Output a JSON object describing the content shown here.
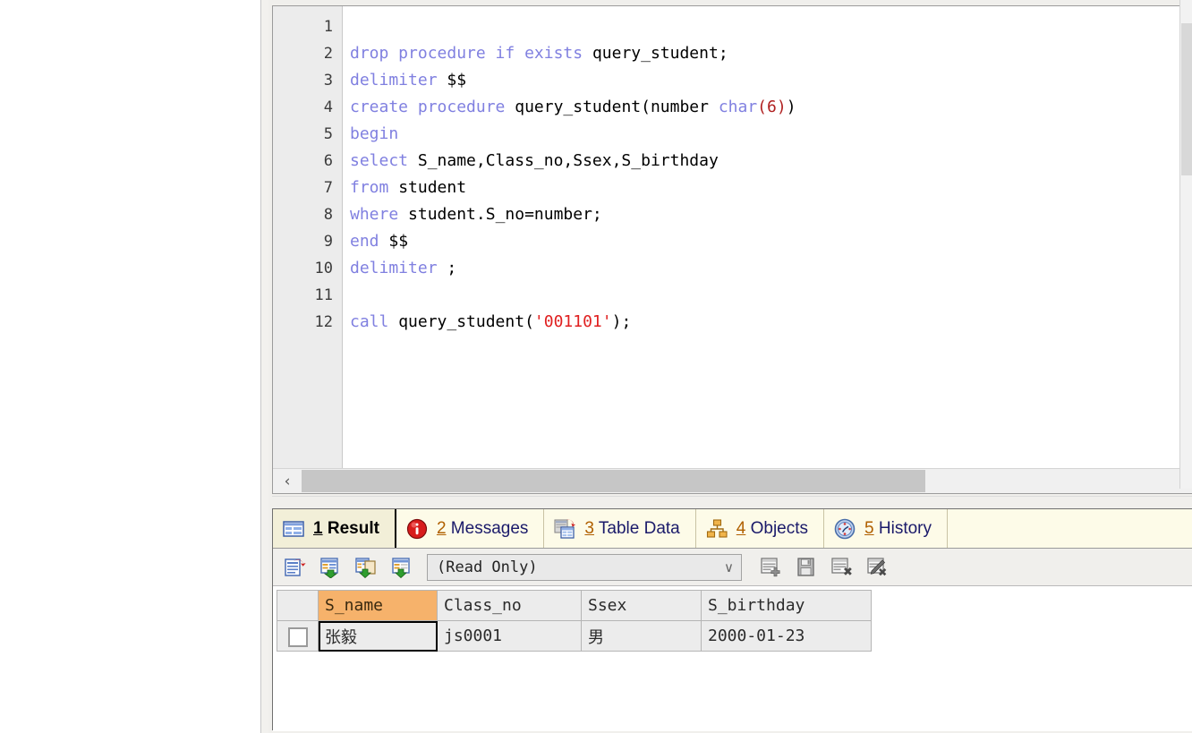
{
  "editor": {
    "line_numbers": [
      "1",
      "2",
      "3",
      "4",
      "5",
      "6",
      "7",
      "8",
      "9",
      "10",
      "11",
      "12"
    ],
    "lines": [
      {
        "n": "1",
        "tokens": [
          {
            "t": "",
            "c": "pln"
          }
        ]
      },
      {
        "n": "2",
        "tokens": [
          {
            "t": "drop procedure if exists ",
            "c": "kw"
          },
          {
            "t": "query_student;",
            "c": "pln"
          }
        ]
      },
      {
        "n": "3",
        "tokens": [
          {
            "t": "delimiter ",
            "c": "kw"
          },
          {
            "t": "$$",
            "c": "pln"
          }
        ]
      },
      {
        "n": "4",
        "tokens": [
          {
            "t": "create procedure ",
            "c": "kw"
          },
          {
            "t": "query_student(number ",
            "c": "pln"
          },
          {
            "t": "char",
            "c": "kw"
          },
          {
            "t": "(6)",
            "c": "num"
          },
          {
            "t": ")",
            "c": "pln"
          }
        ]
      },
      {
        "n": "5",
        "tokens": [
          {
            "t": "begin",
            "c": "kw"
          }
        ]
      },
      {
        "n": "6",
        "tokens": [
          {
            "t": "select ",
            "c": "kw"
          },
          {
            "t": "S_name,Class_no,Ssex,S_birthday",
            "c": "pln"
          }
        ]
      },
      {
        "n": "7",
        "tokens": [
          {
            "t": "from ",
            "c": "kw"
          },
          {
            "t": "student",
            "c": "pln"
          }
        ]
      },
      {
        "n": "8",
        "tokens": [
          {
            "t": "where ",
            "c": "kw"
          },
          {
            "t": "student.S_no=number;",
            "c": "pln"
          }
        ]
      },
      {
        "n": "9",
        "tokens": [
          {
            "t": "end ",
            "c": "kw"
          },
          {
            "t": "$$",
            "c": "pln"
          }
        ]
      },
      {
        "n": "10",
        "tokens": [
          {
            "t": "delimiter ",
            "c": "kw"
          },
          {
            "t": ";",
            "c": "pln"
          }
        ]
      },
      {
        "n": "11",
        "tokens": [
          {
            "t": "",
            "c": "pln"
          }
        ]
      },
      {
        "n": "12",
        "tokens": [
          {
            "t": "call ",
            "c": "kw"
          },
          {
            "t": "query_student(",
            "c": "pln"
          },
          {
            "t": "'001101'",
            "c": "str"
          },
          {
            "t": ");",
            "c": "pln"
          }
        ]
      }
    ],
    "scroll_left_arrow": "‹"
  },
  "result_tabs": [
    {
      "num": "1",
      "label": "Result",
      "icon": "result-grid-icon",
      "active": true
    },
    {
      "num": "2",
      "label": "Messages",
      "icon": "info-circle-icon",
      "active": false
    },
    {
      "num": "3",
      "label": "Table Data",
      "icon": "table-data-icon",
      "active": false
    },
    {
      "num": "4",
      "label": "Objects",
      "icon": "objects-tree-icon",
      "active": false
    },
    {
      "num": "5",
      "label": "History",
      "icon": "history-clock-icon",
      "active": false
    }
  ],
  "toolbar": {
    "buttons_left": [
      {
        "name": "refresh-grid-button",
        "title": "Refresh"
      },
      {
        "name": "export-grid-button",
        "title": "Export"
      },
      {
        "name": "copy-grid-button",
        "title": "Copy"
      },
      {
        "name": "import-grid-button",
        "title": "Import"
      }
    ],
    "mode_select": {
      "value": "(Read Only)",
      "chevron": "∨",
      "options": [
        "(Read Only)"
      ]
    },
    "buttons_right": [
      {
        "name": "add-record-button",
        "title": "Add Record"
      },
      {
        "name": "save-record-button",
        "title": "Save Record"
      },
      {
        "name": "delete-record-button",
        "title": "Delete Record"
      },
      {
        "name": "edit-record-button",
        "title": "Edit Record"
      }
    ]
  },
  "grid": {
    "columns": [
      "S_name",
      "Class_no",
      "Ssex",
      "S_birthday"
    ],
    "selected_column": "S_name",
    "rows": [
      {
        "checked": false,
        "cells": [
          "张毅",
          "js0001",
          "男",
          "2000-01-23"
        ]
      }
    ],
    "active_cell": {
      "row": 0,
      "col": 0
    }
  },
  "colors": {
    "keyword": "#8080e0",
    "string": "#e02020",
    "number": "#b02020",
    "plain": "#000000",
    "tab_bar_bg": "#fdfbe8",
    "selected_header": "#f6b26b",
    "tab_link": "#1a1a6a"
  }
}
